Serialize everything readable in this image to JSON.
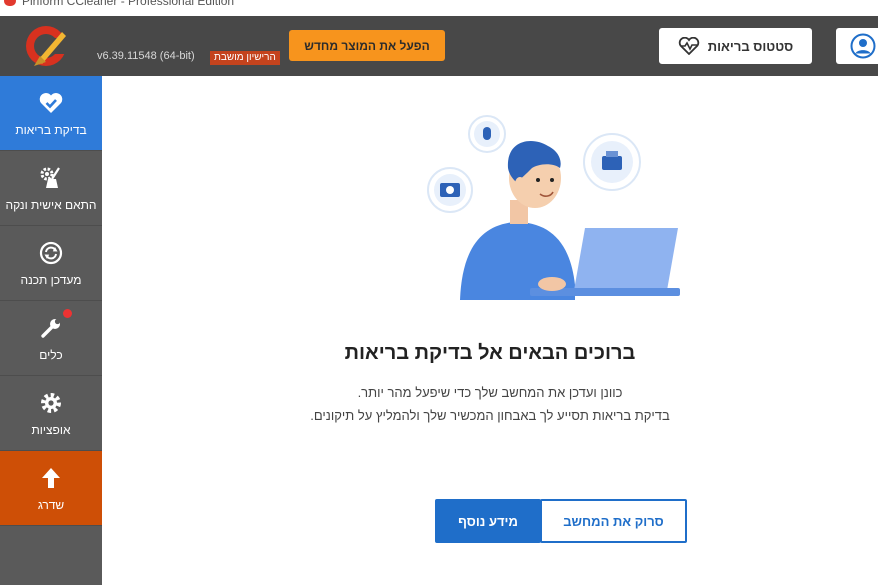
{
  "window": {
    "title": "Piriform CCleaner - Professional Edition"
  },
  "header": {
    "version": "v6.39.11548 (64-bit)",
    "license_badge": "הרישיון מושבת",
    "activate_label": "הפעל את המוצר מחדש",
    "health_status_label": "סטטוס בריאות",
    "account_icon": "user-circle-icon"
  },
  "sidebar": {
    "items": [
      {
        "label": "בדיקת בריאות",
        "icon": "heart-check-icon",
        "active": true
      },
      {
        "label": "התאם אישית ונקה",
        "icon": "gear-broom-icon",
        "active": false
      },
      {
        "label": "מעדכן תכנה",
        "icon": "refresh-icon",
        "active": false
      },
      {
        "label": "כלים",
        "icon": "wrench-icon",
        "active": false,
        "notification": true
      },
      {
        "label": "אופציות",
        "icon": "gear-icon",
        "active": false
      },
      {
        "label": "שדרג",
        "icon": "arrow-up-icon",
        "active": false
      }
    ]
  },
  "main": {
    "title": "ברוכים הבאים אל בדיקת בריאות",
    "description_line1": "כוונן ועדכן את המחשב שלך כדי שיפעל מהר יותר.",
    "description_line2": "בדיקת בריאות תסייע לך באבחון המכשיר שלך ולהמליץ על תיקונים.",
    "learn_more_label": "מידע נוסף",
    "scan_label": "סרוק את המחשב"
  },
  "colors": {
    "header_bg": "#484848",
    "sidebar_bg": "#5a5a5a",
    "active_nav": "#2f7bd9",
    "upgrade_nav": "#ce4f06",
    "activate_button": "#f7941d",
    "primary_blue": "#1f6ec9"
  }
}
